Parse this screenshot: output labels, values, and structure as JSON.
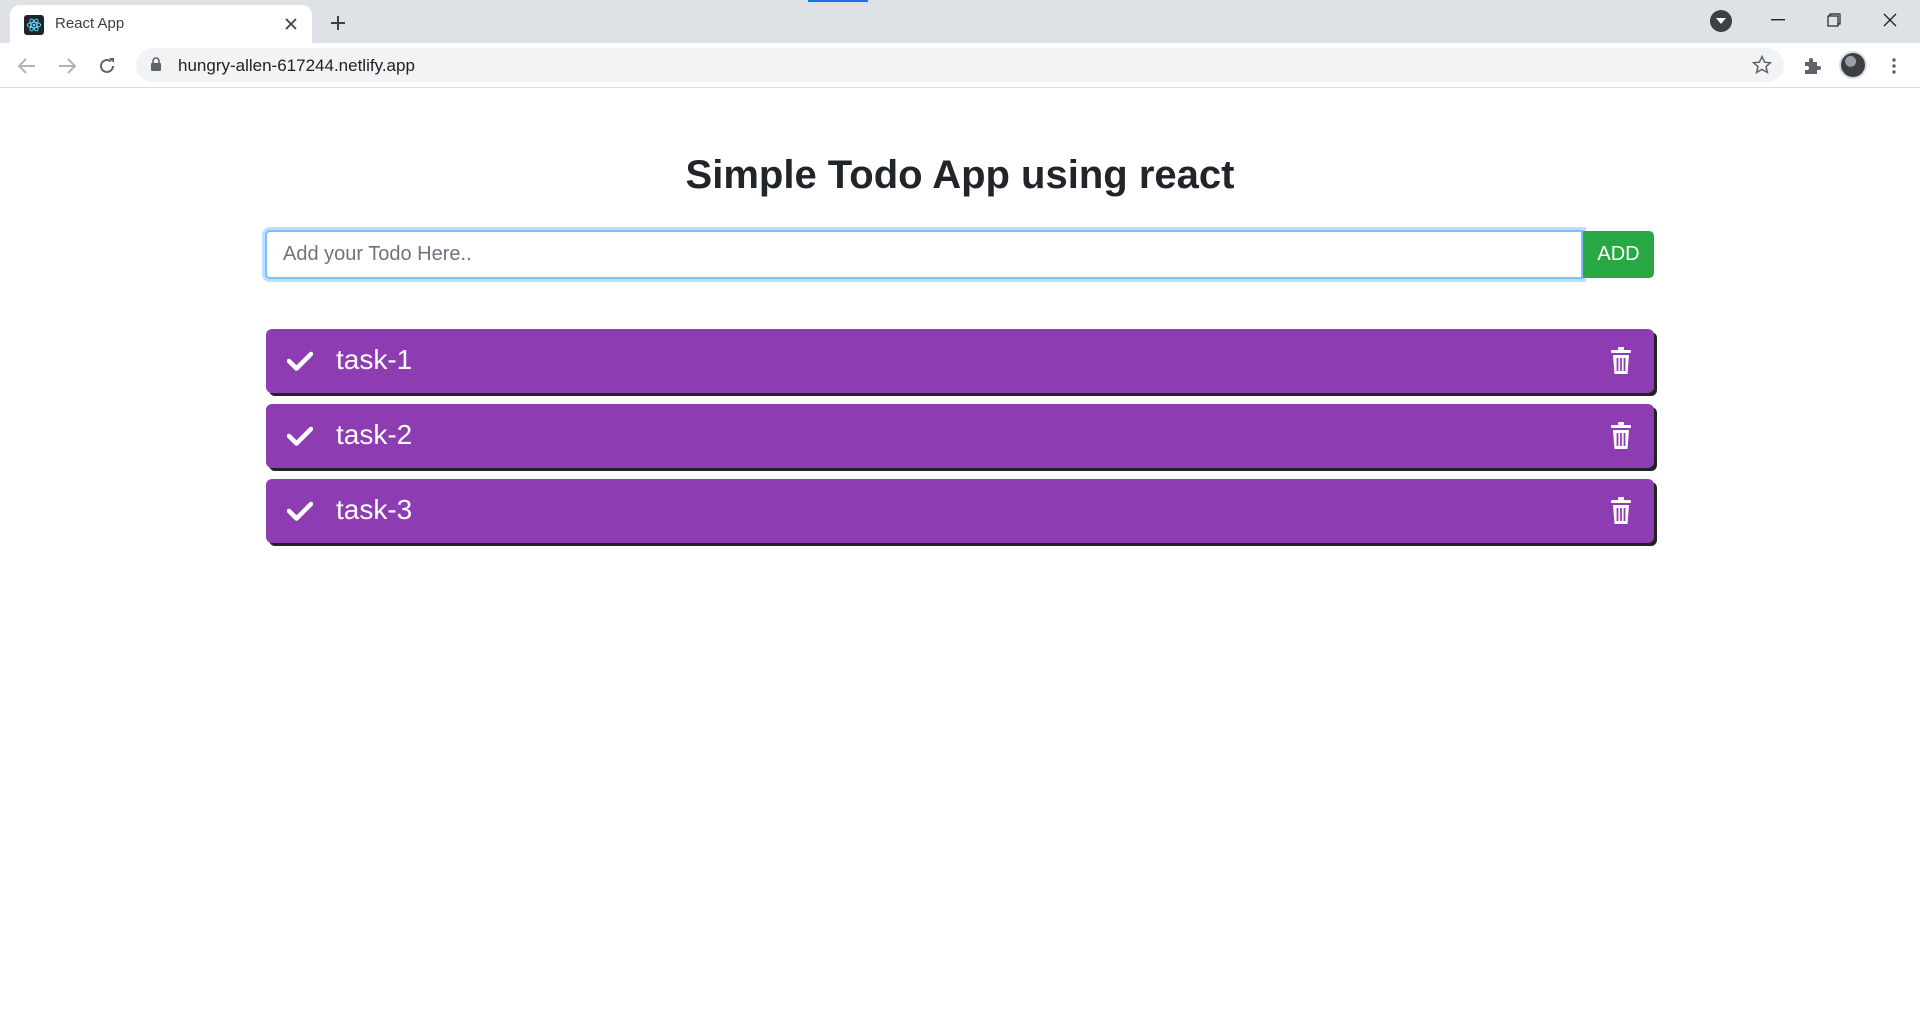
{
  "browser": {
    "tab_title": "React App",
    "url": "hungry-allen-617244.netlify.app",
    "icons": {
      "favicon": "react-logo-icon",
      "tab_close": "close-icon",
      "new_tab": "plus-icon",
      "back": "arrow-left-icon",
      "forward": "arrow-right-icon",
      "reload": "reload-icon",
      "lock": "lock-icon",
      "bookmark": "star-icon",
      "extensions": "puzzle-icon",
      "menu": "kebab-menu-icon"
    }
  },
  "app": {
    "heading": "Simple Todo App using react",
    "input_placeholder": "Add your Todo Here..",
    "input_value": "",
    "add_label": "ADD",
    "colors": {
      "todo_bg": "#8e3cb1",
      "add_button": "#28a745",
      "input_focus": "#80bdff"
    },
    "todos": [
      {
        "text": "task-1"
      },
      {
        "text": "task-2"
      },
      {
        "text": "task-3"
      }
    ]
  }
}
